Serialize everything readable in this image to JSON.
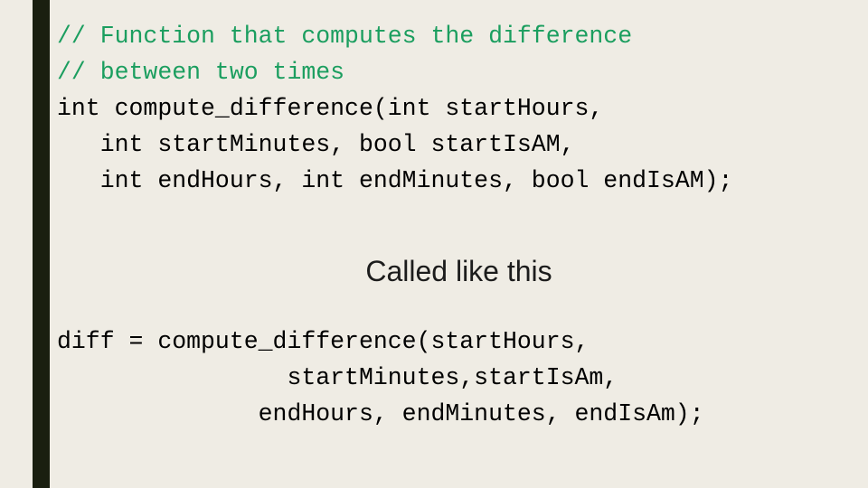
{
  "slide": {
    "background_color": "#efece4",
    "accent_bar_color": "#1a1f10",
    "comment_color": "#1b9e5f",
    "code_color": "#000000",
    "heading_color": "#1c1c1c"
  },
  "declaration_block": {
    "lines": [
      {
        "text": "// Function that computes the difference",
        "kind": "comment"
      },
      {
        "text": "// between two times",
        "kind": "comment"
      },
      {
        "text": "int compute_difference(int startHours,",
        "kind": "code"
      },
      {
        "text": "   int startMinutes, bool startIsAM,",
        "kind": "code"
      },
      {
        "text": "   int endHours, int endMinutes, bool endIsAM);",
        "kind": "code"
      }
    ]
  },
  "heading": {
    "text": "Called like this"
  },
  "call_block": {
    "lines": [
      {
        "text": "diff = compute_difference(startHours,",
        "kind": "code"
      },
      {
        "text": "                startMinutes,startIsAm,",
        "kind": "code"
      },
      {
        "text": "              endHours, endMinutes, endIsAm);",
        "kind": "code"
      }
    ]
  }
}
